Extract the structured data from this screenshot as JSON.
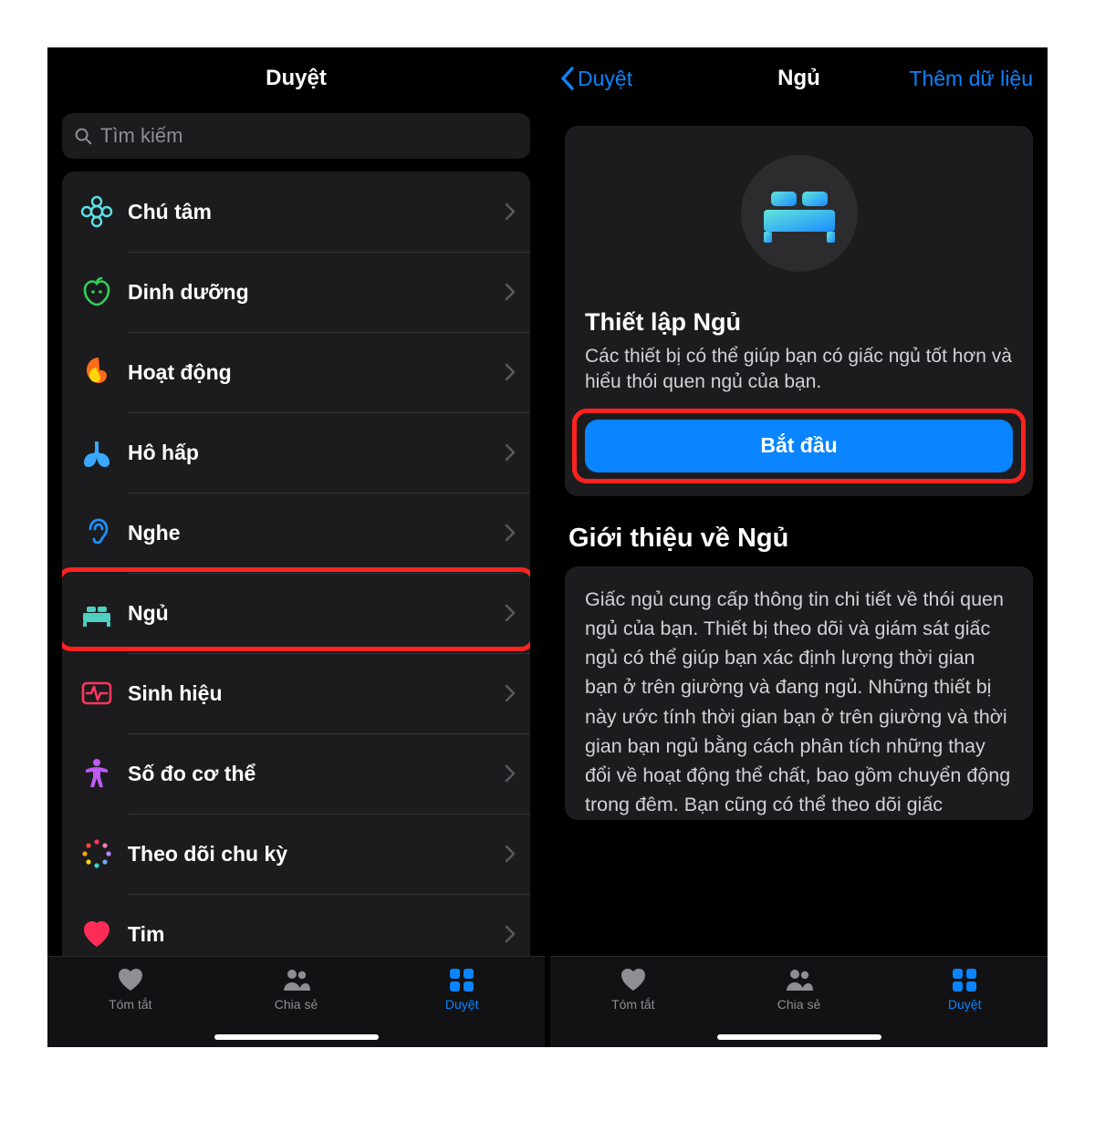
{
  "left": {
    "nav_title": "Duyệt",
    "search_placeholder": "Tìm kiếm",
    "categories": [
      {
        "id": "mindfulness",
        "label": "Chú tâm"
      },
      {
        "id": "nutrition",
        "label": "Dinh dưỡng"
      },
      {
        "id": "activity",
        "label": "Hoạt động"
      },
      {
        "id": "respiratory",
        "label": "Hô hấp"
      },
      {
        "id": "hearing",
        "label": "Nghe"
      },
      {
        "id": "sleep",
        "label": "Ngủ"
      },
      {
        "id": "vitals",
        "label": "Sinh hiệu"
      },
      {
        "id": "body",
        "label": "Số đo cơ thể"
      },
      {
        "id": "cycle",
        "label": "Theo dõi chu kỳ"
      },
      {
        "id": "heart",
        "label": "Tim"
      }
    ]
  },
  "right": {
    "nav_back": "Duyệt",
    "nav_title": "Ngủ",
    "nav_action": "Thêm dữ liệu",
    "setup_title": "Thiết lập Ngủ",
    "setup_desc": "Các thiết bị có thể giúp bạn có giấc ngủ tốt hơn và hiểu thói quen ngủ của bạn.",
    "setup_cta": "Bắt đầu",
    "about_title": "Giới thiệu về Ngủ",
    "about_body": "Giấc ngủ cung cấp thông tin chi tiết về thói quen ngủ của bạn. Thiết bị theo dõi và giám sát giấc ngủ có thể giúp bạn xác định lượng thời gian bạn ở trên giường và đang ngủ. Những thiết bị này ước tính thời gian bạn ở trên giường và thời gian bạn ngủ bằng cách phân tích những thay đổi về hoạt động thể chất, bao gồm chuyển động trong đêm. Bạn cũng có thể theo dõi giấc"
  },
  "tabbar": {
    "summary": "Tóm tắt",
    "sharing": "Chia sẻ",
    "browse": "Duyệt"
  }
}
